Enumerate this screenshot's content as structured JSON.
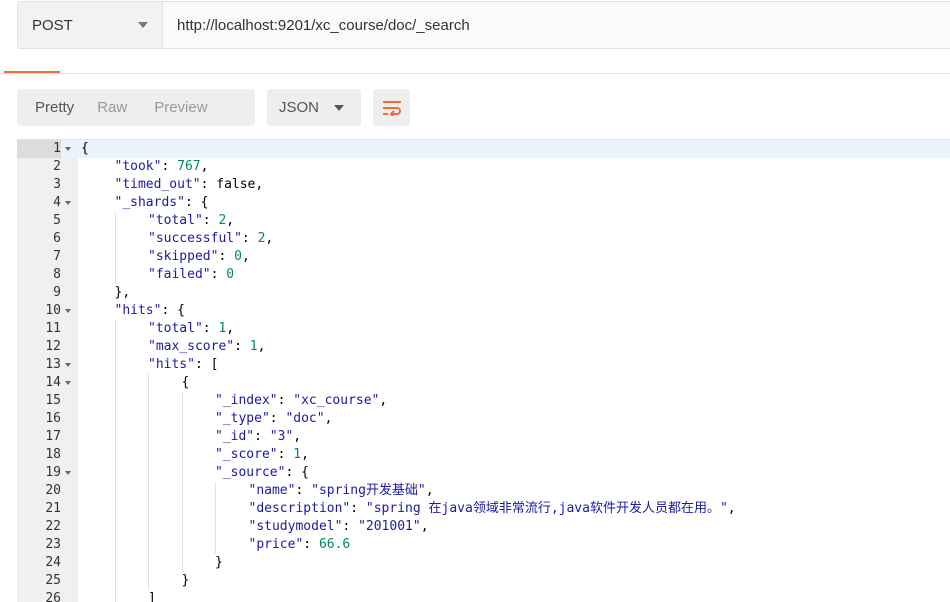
{
  "request": {
    "method": "POST",
    "url": "http://localhost:9201/xc_course/doc/_search"
  },
  "response_toolbar": {
    "views": [
      "Pretty",
      "Raw",
      "Preview"
    ],
    "active_view": "Pretty",
    "format": "JSON",
    "wrap_icon": "wrap-lines-icon"
  },
  "colors": {
    "accent": "#f26b3a",
    "key": "#1a1aa6",
    "string": "#1a1aa6",
    "number": "#09885a",
    "gutter_bg": "#f0f0f0",
    "active_line": "#eaf2fb"
  },
  "editor": {
    "lines": [
      {
        "n": "1",
        "fold": true,
        "indent": 0,
        "tokens": [
          [
            "p",
            "{"
          ]
        ]
      },
      {
        "n": "2",
        "fold": false,
        "indent": 1,
        "tokens": [
          [
            "k",
            "\"took\""
          ],
          [
            "p",
            ": "
          ],
          [
            "n",
            "767"
          ],
          [
            "p",
            ","
          ]
        ]
      },
      {
        "n": "3",
        "fold": false,
        "indent": 1,
        "tokens": [
          [
            "k",
            "\"timed_out\""
          ],
          [
            "p",
            ": "
          ],
          [
            "b",
            "false"
          ],
          [
            "p",
            ","
          ]
        ]
      },
      {
        "n": "4",
        "fold": true,
        "indent": 1,
        "tokens": [
          [
            "k",
            "\"_shards\""
          ],
          [
            "p",
            ": {"
          ]
        ]
      },
      {
        "n": "5",
        "fold": false,
        "indent": 2,
        "tokens": [
          [
            "k",
            "\"total\""
          ],
          [
            "p",
            ": "
          ],
          [
            "n",
            "2"
          ],
          [
            "p",
            ","
          ]
        ]
      },
      {
        "n": "6",
        "fold": false,
        "indent": 2,
        "tokens": [
          [
            "k",
            "\"successful\""
          ],
          [
            "p",
            ": "
          ],
          [
            "n",
            "2"
          ],
          [
            "p",
            ","
          ]
        ]
      },
      {
        "n": "7",
        "fold": false,
        "indent": 2,
        "tokens": [
          [
            "k",
            "\"skipped\""
          ],
          [
            "p",
            ": "
          ],
          [
            "n",
            "0"
          ],
          [
            "p",
            ","
          ]
        ]
      },
      {
        "n": "8",
        "fold": false,
        "indent": 2,
        "tokens": [
          [
            "k",
            "\"failed\""
          ],
          [
            "p",
            ": "
          ],
          [
            "n",
            "0"
          ]
        ]
      },
      {
        "n": "9",
        "fold": false,
        "indent": 1,
        "tokens": [
          [
            "p",
            "},"
          ]
        ]
      },
      {
        "n": "10",
        "fold": true,
        "indent": 1,
        "tokens": [
          [
            "k",
            "\"hits\""
          ],
          [
            "p",
            ": {"
          ]
        ]
      },
      {
        "n": "11",
        "fold": false,
        "indent": 2,
        "tokens": [
          [
            "k",
            "\"total\""
          ],
          [
            "p",
            ": "
          ],
          [
            "n",
            "1"
          ],
          [
            "p",
            ","
          ]
        ]
      },
      {
        "n": "12",
        "fold": false,
        "indent": 2,
        "tokens": [
          [
            "k",
            "\"max_score\""
          ],
          [
            "p",
            ": "
          ],
          [
            "n",
            "1"
          ],
          [
            "p",
            ","
          ]
        ]
      },
      {
        "n": "13",
        "fold": true,
        "indent": 2,
        "tokens": [
          [
            "k",
            "\"hits\""
          ],
          [
            "p",
            ": ["
          ]
        ]
      },
      {
        "n": "14",
        "fold": true,
        "indent": 3,
        "tokens": [
          [
            "p",
            "{"
          ]
        ]
      },
      {
        "n": "15",
        "fold": false,
        "indent": 4,
        "tokens": [
          [
            "k",
            "\"_index\""
          ],
          [
            "p",
            ": "
          ],
          [
            "s",
            "\"xc_course\""
          ],
          [
            "p",
            ","
          ]
        ]
      },
      {
        "n": "16",
        "fold": false,
        "indent": 4,
        "tokens": [
          [
            "k",
            "\"_type\""
          ],
          [
            "p",
            ": "
          ],
          [
            "s",
            "\"doc\""
          ],
          [
            "p",
            ","
          ]
        ]
      },
      {
        "n": "17",
        "fold": false,
        "indent": 4,
        "tokens": [
          [
            "k",
            "\"_id\""
          ],
          [
            "p",
            ": "
          ],
          [
            "s",
            "\"3\""
          ],
          [
            "p",
            ","
          ]
        ]
      },
      {
        "n": "18",
        "fold": false,
        "indent": 4,
        "tokens": [
          [
            "k",
            "\"_score\""
          ],
          [
            "p",
            ": "
          ],
          [
            "n",
            "1"
          ],
          [
            "p",
            ","
          ]
        ]
      },
      {
        "n": "19",
        "fold": true,
        "indent": 4,
        "tokens": [
          [
            "k",
            "\"_source\""
          ],
          [
            "p",
            ": {"
          ]
        ]
      },
      {
        "n": "20",
        "fold": false,
        "indent": 5,
        "tokens": [
          [
            "k",
            "\"name\""
          ],
          [
            "p",
            ": "
          ],
          [
            "s",
            "\"spring开发基础\""
          ],
          [
            "p",
            ","
          ]
        ]
      },
      {
        "n": "21",
        "fold": false,
        "indent": 5,
        "tokens": [
          [
            "k",
            "\"description\""
          ],
          [
            "p",
            ": "
          ],
          [
            "s",
            "\"spring 在java领域非常流行,java软件开发人员都在用。\""
          ],
          [
            "p",
            ","
          ]
        ]
      },
      {
        "n": "22",
        "fold": false,
        "indent": 5,
        "tokens": [
          [
            "k",
            "\"studymodel\""
          ],
          [
            "p",
            ": "
          ],
          [
            "s",
            "\"201001\""
          ],
          [
            "p",
            ","
          ]
        ]
      },
      {
        "n": "23",
        "fold": false,
        "indent": 5,
        "tokens": [
          [
            "k",
            "\"price\""
          ],
          [
            "p",
            ": "
          ],
          [
            "n",
            "66.6"
          ]
        ]
      },
      {
        "n": "24",
        "fold": false,
        "indent": 4,
        "tokens": [
          [
            "p",
            "}"
          ]
        ]
      },
      {
        "n": "25",
        "fold": false,
        "indent": 3,
        "tokens": [
          [
            "p",
            "}"
          ]
        ]
      },
      {
        "n": "26",
        "fold": false,
        "indent": 2,
        "tokens": [
          [
            "p",
            "]"
          ]
        ]
      }
    ]
  }
}
